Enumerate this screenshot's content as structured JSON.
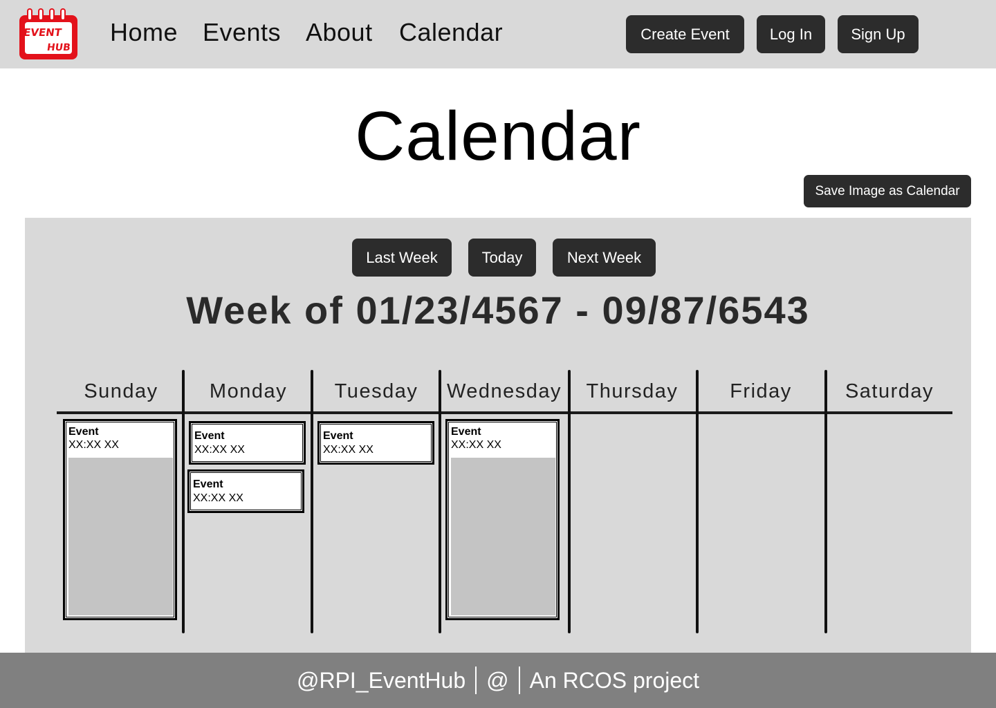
{
  "header": {
    "logo_text_line1": "EVENT",
    "logo_text_line2": "HUB",
    "nav": [
      "Home",
      "Events",
      "About",
      "Calendar"
    ],
    "buttons": {
      "create_event": "Create Event",
      "log_in": "Log In",
      "sign_up": "Sign Up"
    }
  },
  "page": {
    "title": "Calendar",
    "save_button": "Save Image as Calendar"
  },
  "calendar": {
    "week_buttons": {
      "last_week": "Last Week",
      "today": "Today",
      "next_week": "Next Week"
    },
    "week_title": "Week of 01/23/4567 - 09/87/6543",
    "days": [
      "Sunday",
      "Monday",
      "Tuesday",
      "Wednesday",
      "Thursday",
      "Friday",
      "Saturday"
    ],
    "events": [
      {
        "day": "Sunday",
        "name": "Event",
        "time": "XX:XX XX",
        "has_image": true
      },
      {
        "day": "Monday",
        "name": "Event",
        "time": "XX:XX XX",
        "has_image": false
      },
      {
        "day": "Monday",
        "name": "Event",
        "time": "XX:XX XX",
        "has_image": false
      },
      {
        "day": "Tuesday",
        "name": "Event",
        "time": "XX:XX XX",
        "has_image": false
      },
      {
        "day": "Wednesday",
        "name": "Event",
        "time": "XX:XX XX",
        "has_image": true
      }
    ]
  },
  "footer": {
    "handle": "@RPI_EventHub",
    "at": "@",
    "tagline": "An RCOS project"
  },
  "colors": {
    "logo_red": "#e3121b",
    "header_bg": "#d9d9d9",
    "button_dark": "#2c2c2c",
    "footer_bg": "#808080"
  }
}
